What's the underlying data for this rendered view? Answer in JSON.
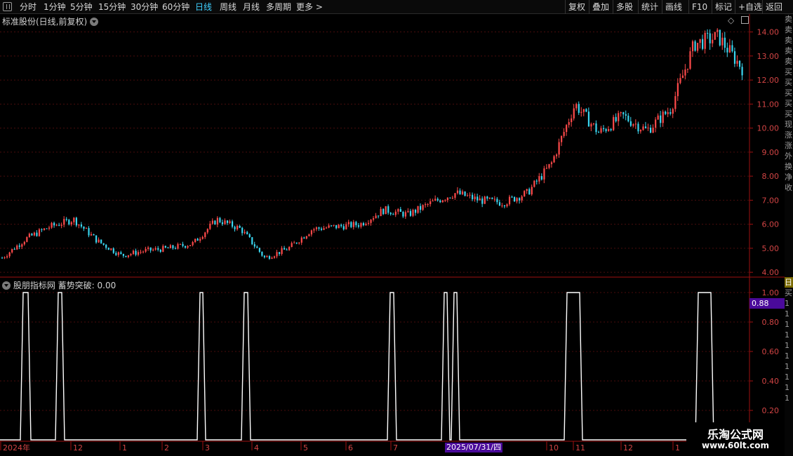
{
  "toolbar": {
    "periods": [
      "分时",
      "1分钟",
      "5分钟",
      "15分钟",
      "30分钟",
      "60分钟",
      "日线",
      "周线",
      "月线",
      "多周期",
      "更多 >"
    ],
    "active_period": "日线",
    "actions": [
      "复权",
      "叠加",
      "多股",
      "统计",
      "画线",
      "F10",
      "标记",
      "+自选",
      "返回"
    ]
  },
  "main_panel": {
    "title": "标准股份(日线,前复权)",
    "y_ticks": [
      "14.00",
      "13.00",
      "12.00",
      "11.00",
      "10.00",
      "9.00",
      "8.00",
      "7.00",
      "6.00",
      "5.00",
      "4.00"
    ]
  },
  "indicator_panel": {
    "title": "股朋指标网  蓄势突破: 0.00",
    "y_ticks": [
      "1.00",
      "0.80",
      "0.60",
      "0.40",
      "0.20"
    ],
    "current_value": "0.88"
  },
  "x_axis": {
    "labels": [
      "2024年",
      "12",
      "1",
      "2",
      "3",
      "4",
      "5",
      "6",
      "7",
      "10",
      "11",
      "12",
      "1"
    ],
    "cursor_date": "2025/07/31/四"
  },
  "right_strip": [
    "卖",
    "卖",
    "卖",
    "卖",
    "卖",
    "买",
    "买",
    "买",
    "买",
    "买",
    "现",
    "涨",
    "涨",
    "外",
    "换",
    "净",
    "收"
  ],
  "right_strip_lower": [
    "日",
    "买",
    "1",
    "1",
    "1",
    "1",
    "1",
    "1",
    "1",
    "1",
    "1",
    "1"
  ],
  "watermark": {
    "line1": "乐淘公式网",
    "line2": "www.60lt.com"
  },
  "colors": {
    "up": "#ff4a4a",
    "down": "#3ad6f0",
    "axis": "#a01010",
    "grid": "#4a0d0d",
    "indicator_line": "#ffffff",
    "highlight": "#4a0a9a"
  },
  "chart_data": [
    {
      "type": "candlestick",
      "title": "标准股份(日线,前复权)",
      "ylim": [
        3.8,
        14.6
      ],
      "approx_close_path": [
        [
          "2024-11",
          4.6
        ],
        [
          "2024-11",
          5.4
        ],
        [
          "2024-12",
          5.9
        ],
        [
          "2024-12",
          6.2
        ],
        [
          "2025-01",
          5.3
        ],
        [
          "2025-01",
          4.7
        ],
        [
          "2025-02",
          4.9
        ],
        [
          "2025-02",
          5.0
        ],
        [
          "2025-03",
          5.2
        ],
        [
          "2025-03",
          6.2
        ],
        [
          "2025-03",
          5.8
        ],
        [
          "2025-04",
          4.6
        ],
        [
          "2025-04",
          5.0
        ],
        [
          "2025-05",
          5.8
        ],
        [
          "2025-05",
          5.9
        ],
        [
          "2025-06",
          6.0
        ],
        [
          "2025-06",
          6.6
        ],
        [
          "2025-07",
          6.4
        ],
        [
          "2025-07",
          6.9
        ],
        [
          "2025-08",
          7.3
        ],
        [
          "2025-08",
          7.0
        ],
        [
          "2025-09",
          6.9
        ],
        [
          "2025-09",
          7.3
        ],
        [
          "2025-10",
          8.5
        ],
        [
          "2025-10",
          11.0
        ],
        [
          "2025-11",
          9.8
        ],
        [
          "2025-11",
          10.5
        ],
        [
          "2025-12",
          9.9
        ],
        [
          "2025-12",
          10.8
        ],
        [
          "2026-01",
          13.5
        ],
        [
          "2026-01",
          13.8
        ],
        [
          "2026-01",
          12.5
        ]
      ]
    },
    {
      "type": "line",
      "title": "蓄势突破",
      "ylim": [
        0,
        1
      ],
      "signal_value": 1,
      "baseline_value": 0,
      "signals": [
        "2024-11",
        "2024-12",
        "2025-03",
        "2025-04",
        "2025-07",
        "2025-08",
        "2025-08",
        "2025-11",
        "2026-01"
      ]
    }
  ]
}
